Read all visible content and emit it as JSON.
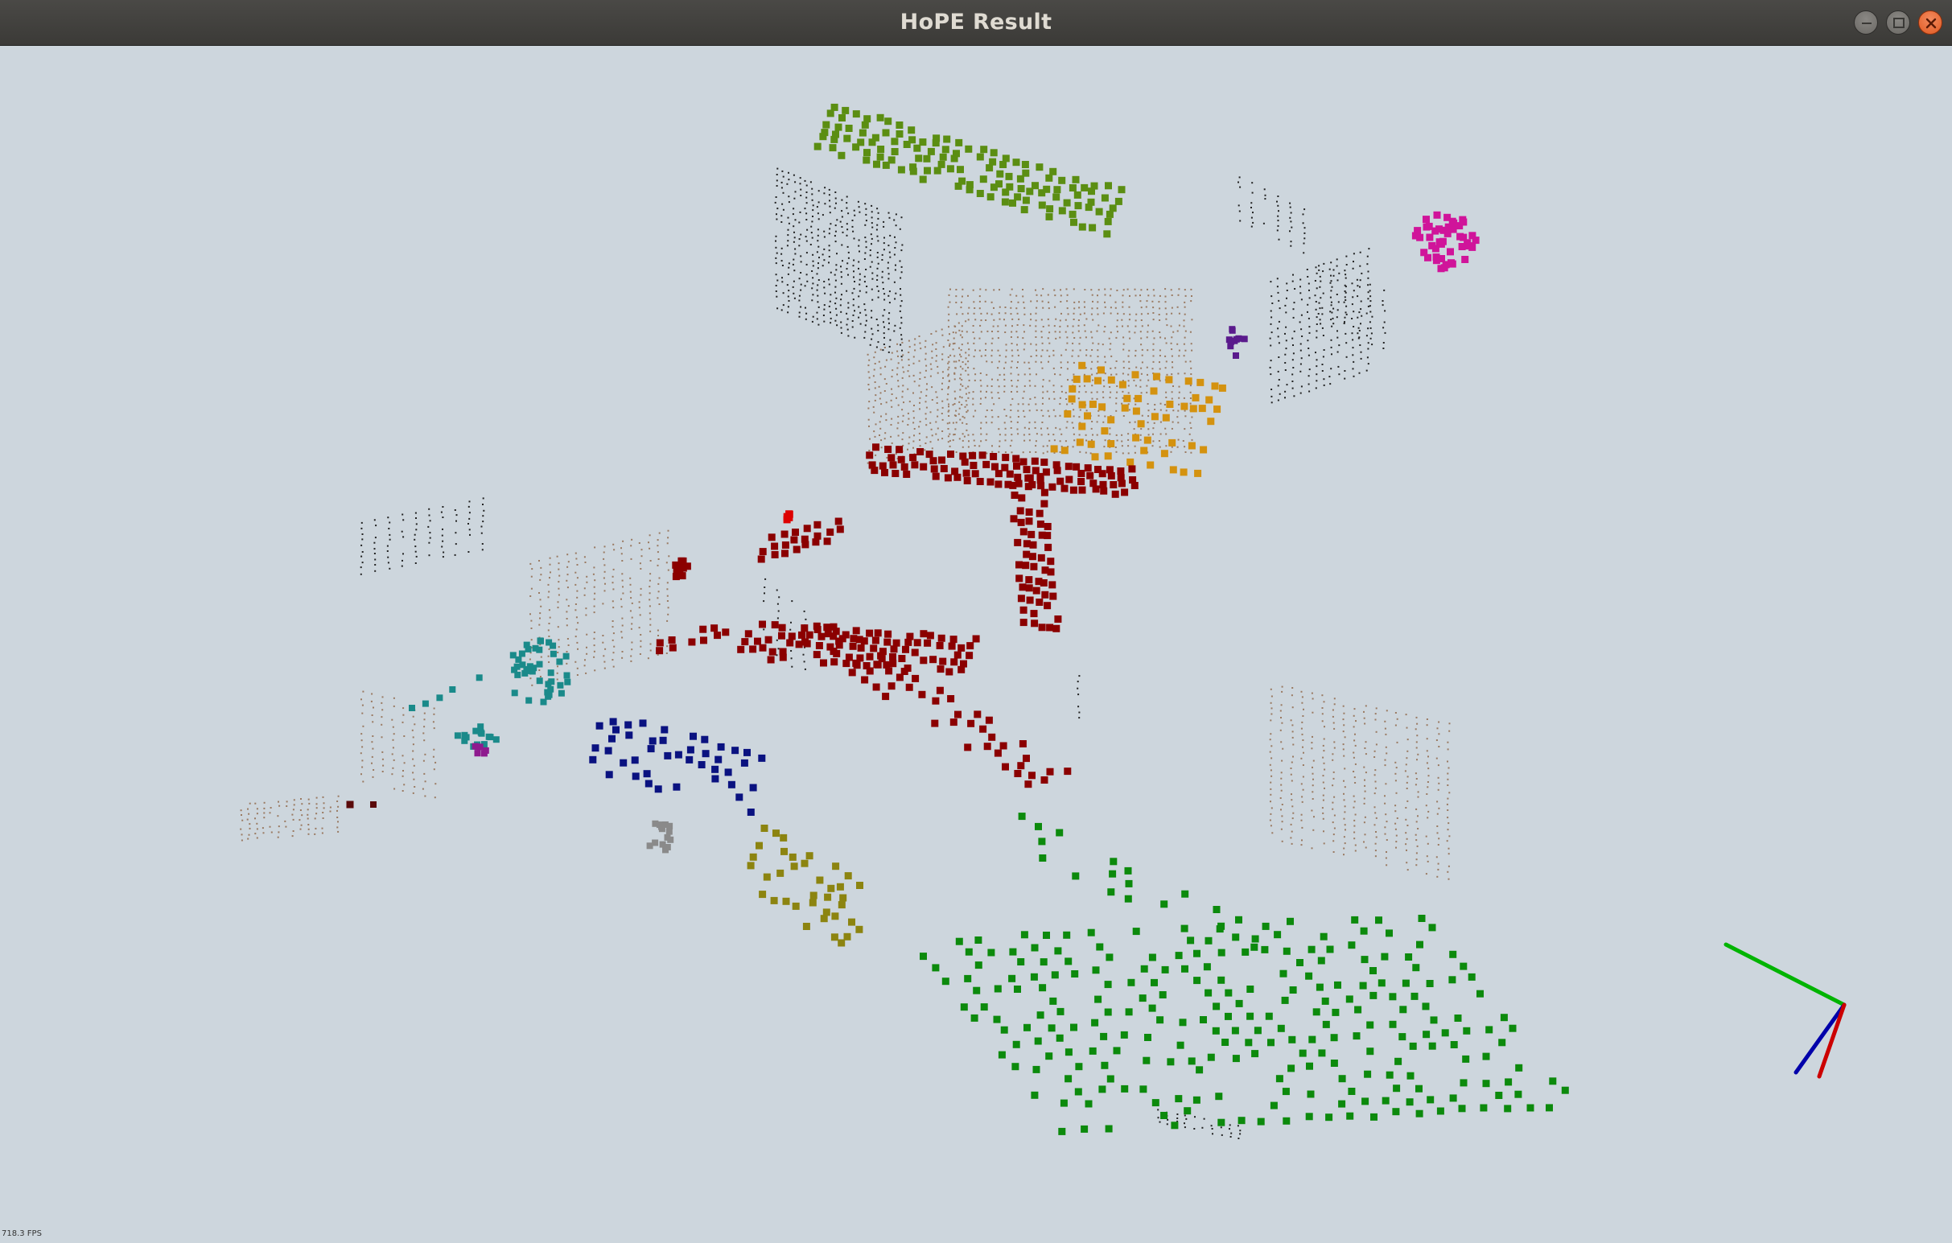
{
  "window": {
    "title": "HoPE Result",
    "controls": [
      "minimize",
      "maximize",
      "close"
    ]
  },
  "status": {
    "fps_text": "718.3 FPS"
  },
  "scene": {
    "background_color": "#cdd6dd",
    "raw_points_color": "#222222",
    "plane_clusters": [
      {
        "name": "green-top",
        "color": "#5b8e12"
      },
      {
        "name": "magenta",
        "color": "#d0149a"
      },
      {
        "name": "purple-small",
        "color": "#5a1a8c"
      },
      {
        "name": "orange",
        "color": "#d4920f"
      },
      {
        "name": "dark-red",
        "color": "#8b0000"
      },
      {
        "name": "red-small",
        "color": "#dd0000"
      },
      {
        "name": "teal",
        "color": "#1a8a8a"
      },
      {
        "name": "magenta-small",
        "color": "#8e1a8e"
      },
      {
        "name": "navy",
        "color": "#0a1280"
      },
      {
        "name": "gray",
        "color": "#8a8a8a"
      },
      {
        "name": "olive",
        "color": "#8c8410"
      },
      {
        "name": "green-floor",
        "color": "#0c8a0c"
      },
      {
        "name": "maroon-small",
        "color": "#5a0a0a"
      }
    ],
    "axes": {
      "x_color": "#cc0000",
      "y_color": "#00b400",
      "z_color": "#0000aa"
    }
  }
}
